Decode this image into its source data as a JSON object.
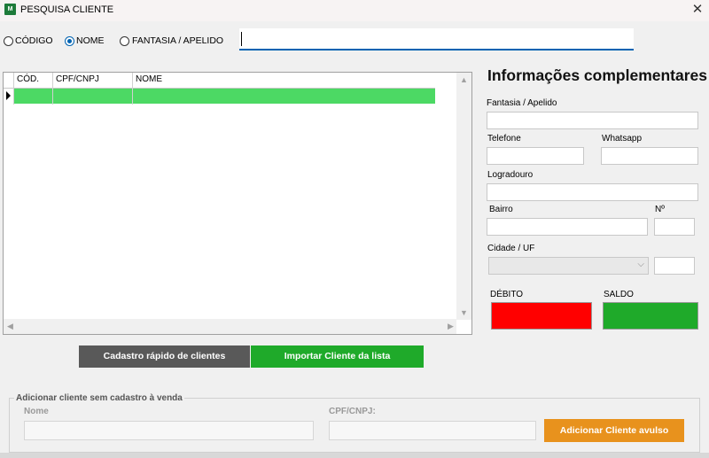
{
  "window": {
    "title": "PESQUISA CLIENTE",
    "icon": "app-icon",
    "close_glyph": "✕"
  },
  "search": {
    "options": [
      {
        "label": "CÓDIGO",
        "checked": false
      },
      {
        "label": "NOME",
        "checked": true
      },
      {
        "label": "FANTASIA / APELIDO",
        "checked": false
      }
    ],
    "value": ""
  },
  "grid": {
    "columns": [
      "CÓD.",
      "CPF/CNPJ",
      "NOME"
    ],
    "rows": [
      {
        "cod": "",
        "cpf_cnpj": "",
        "nome": ""
      }
    ],
    "selected_row_color": "#4cd964"
  },
  "info": {
    "title": "Informações complementares",
    "fields": {
      "fantasia": {
        "label": "Fantasia / Apelido",
        "value": ""
      },
      "telefone": {
        "label": "Telefone",
        "value": ""
      },
      "whatsapp": {
        "label": "Whatsapp",
        "value": ""
      },
      "logradouro": {
        "label": "Logradouro",
        "value": ""
      },
      "bairro": {
        "label": "Bairro",
        "value": ""
      },
      "numero": {
        "label": "Nº",
        "value": ""
      },
      "cidade_uf": {
        "label": "Cidade / UF",
        "value": ""
      },
      "uf": {
        "value": ""
      }
    },
    "debito": {
      "label": "DÉBITO",
      "color": "#ff0000"
    },
    "saldo": {
      "label": "SALDO",
      "color": "#1faa2a"
    }
  },
  "buttons": {
    "cadastro_rapido": "Cadastro rápido de clientes",
    "importar": "Importar Cliente da lista"
  },
  "avulso": {
    "group_title": "Adicionar cliente sem cadastro à venda",
    "nome_label": "Nome",
    "cpf_label": "CPF/CNPJ:",
    "nome_value": "",
    "cpf_value": "",
    "button": "Adicionar Cliente avulso",
    "button_color": "#e8921d"
  }
}
